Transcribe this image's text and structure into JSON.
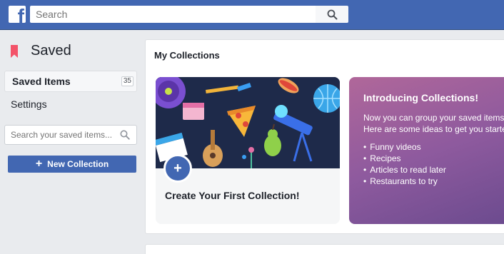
{
  "topbar": {
    "logo_letter": "f",
    "search_placeholder": "Search",
    "search_icon": "search-icon",
    "color": "#4267b2"
  },
  "sidebar": {
    "title": "Saved",
    "title_icon": "bookmark-icon",
    "items": [
      {
        "label": "Saved Items",
        "count": "35",
        "active": true
      },
      {
        "label": "Settings"
      }
    ],
    "search_placeholder": "Search your saved items...",
    "new_collection_label": "New Collection",
    "new_collection_icon": "plus-icon"
  },
  "main": {
    "heading": "My Collections",
    "create_card": {
      "label": "Create Your First Collection!",
      "badge": "+"
    },
    "intro_card": {
      "title": "Introducing Collections!",
      "body_line1": "Now you can group your saved items",
      "body_line2": "Here are some ideas to get you starte",
      "ideas": [
        "Funny videos",
        "Recipes",
        "Articles to read later",
        "Restaurants to try"
      ]
    }
  }
}
